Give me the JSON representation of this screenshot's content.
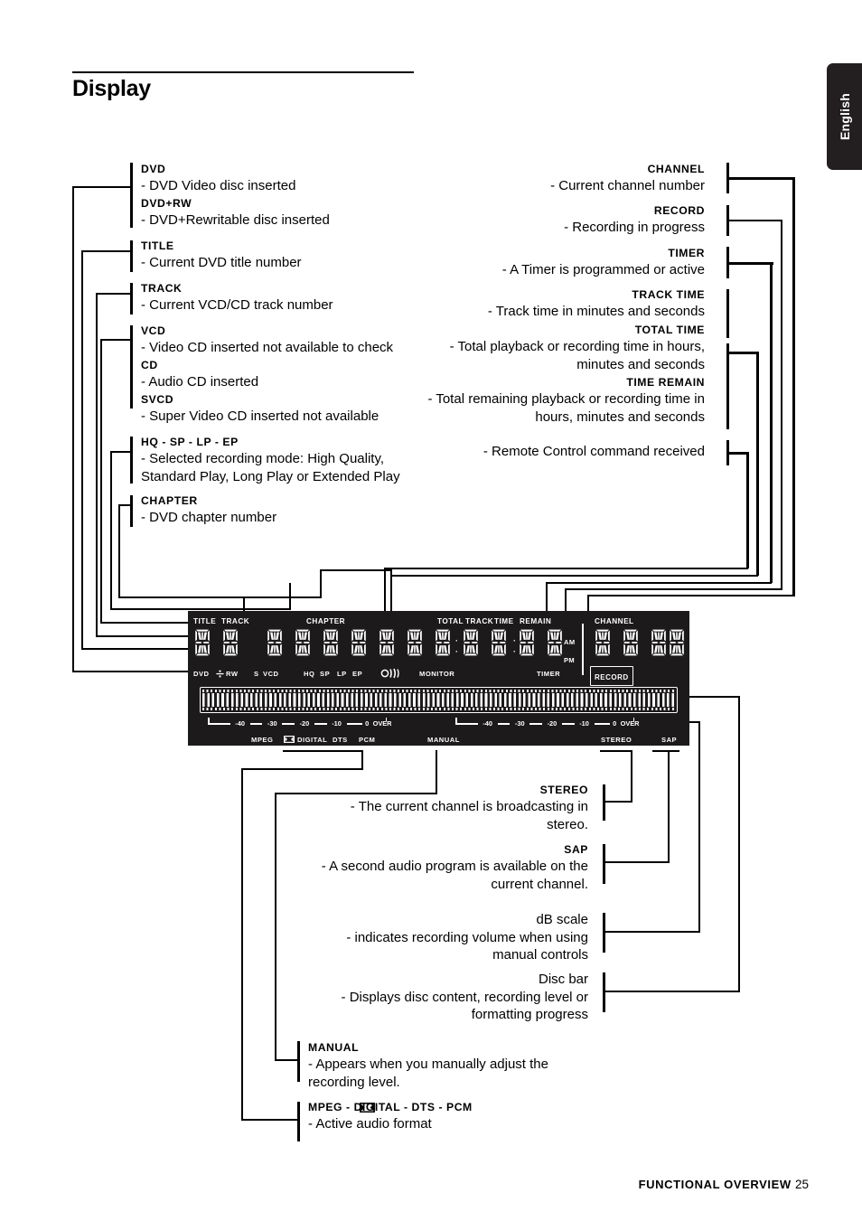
{
  "page": {
    "title": "Display",
    "language_tab": "English",
    "footer_section": "FUNCTIONAL OVERVIEW",
    "footer_page": "25"
  },
  "left_callouts": [
    {
      "heading": "DVD",
      "body": "- DVD Video disc inserted"
    },
    {
      "heading": "DVD+RW",
      "body": "- DVD+Rewritable disc inserted"
    },
    {
      "heading": "TITLE",
      "body": "- Current DVD title number"
    },
    {
      "heading": "TRACK",
      "body": "- Current VCD/CD track number"
    },
    {
      "heading": "VCD",
      "body": "- Video CD inserted not available to check"
    },
    {
      "heading": "CD",
      "body": "- Audio CD inserted"
    },
    {
      "heading": "SVCD",
      "body": "- Super Video CD inserted not available"
    },
    {
      "heading": "HQ - SP - LP - EP",
      "body": "- Selected recording mode: High Quality, Standard Play, Long Play or Extended Play"
    },
    {
      "heading": "CHAPTER",
      "body": "- DVD chapter number"
    }
  ],
  "right_callouts": [
    {
      "heading": "CHANNEL",
      "body": "- Current channel number"
    },
    {
      "heading": "RECORD",
      "body": "- Recording in progress"
    },
    {
      "heading": "TIMER",
      "body": "- A Timer is programmed or active"
    },
    {
      "heading": "TRACK TIME",
      "body": "- Track time in minutes and seconds"
    },
    {
      "heading": "TOTAL TIME",
      "body": "- Total playback or recording time in hours, minutes and seconds"
    },
    {
      "heading": "TIME REMAIN",
      "body": "- Total remaining playback or recording time in hours, minutes and seconds"
    },
    {
      "heading": "",
      "body": "- Remote Control command received"
    }
  ],
  "bottom_callouts": [
    {
      "heading": "STEREO",
      "body": "- The current channel is broadcasting in stereo."
    },
    {
      "heading": "SAP",
      "body": "- A second audio program is available on the current channel."
    },
    {
      "heading": "dB scale",
      "body": "- indicates recording volume when using manual controls"
    },
    {
      "heading": "Disc bar",
      "body": "- Displays disc content, recording level or formatting progress"
    },
    {
      "heading": "MANUAL",
      "body": "- Appears when you manually adjust the recording level."
    },
    {
      "heading": "MPEG -  DIGITAL - DTS - PCM",
      "body": "- Active audio format"
    }
  ],
  "display": {
    "top_labels": {
      "title": "TITLE",
      "track": "TRACK",
      "chapter": "CHAPTER",
      "total": "TOTAL",
      "track2": "TRACK",
      "time": "TIME",
      "remain": "REMAIN",
      "channel": "CHANNEL"
    },
    "bottom_labels": {
      "dvd": "DVD",
      "rw": "RW",
      "s": "S",
      "vcd": "VCD",
      "hq": "HQ",
      "sp": "SP",
      "lp": "LP",
      "ep": "EP",
      "monitor": "MONITOR",
      "timer": "TIMER",
      "record": "RECORD"
    },
    "am": "AM",
    "pm": "PM",
    "format_labels": {
      "mpeg": "MPEG",
      "digital": "DIGITAL",
      "dts": "DTS",
      "pcm": "PCM",
      "manual": "MANUAL",
      "stereo": "STEREO",
      "sap": "SAP"
    },
    "db_ticks": [
      "-40",
      "-30",
      "-20",
      "-10",
      "0",
      "OVER"
    ],
    "colors": {
      "panel_bg": "#1c1a1b",
      "segment": "#ffffff",
      "page_bg": "#ffffff",
      "ink": "#000000",
      "tab_bg": "#231f20"
    }
  }
}
